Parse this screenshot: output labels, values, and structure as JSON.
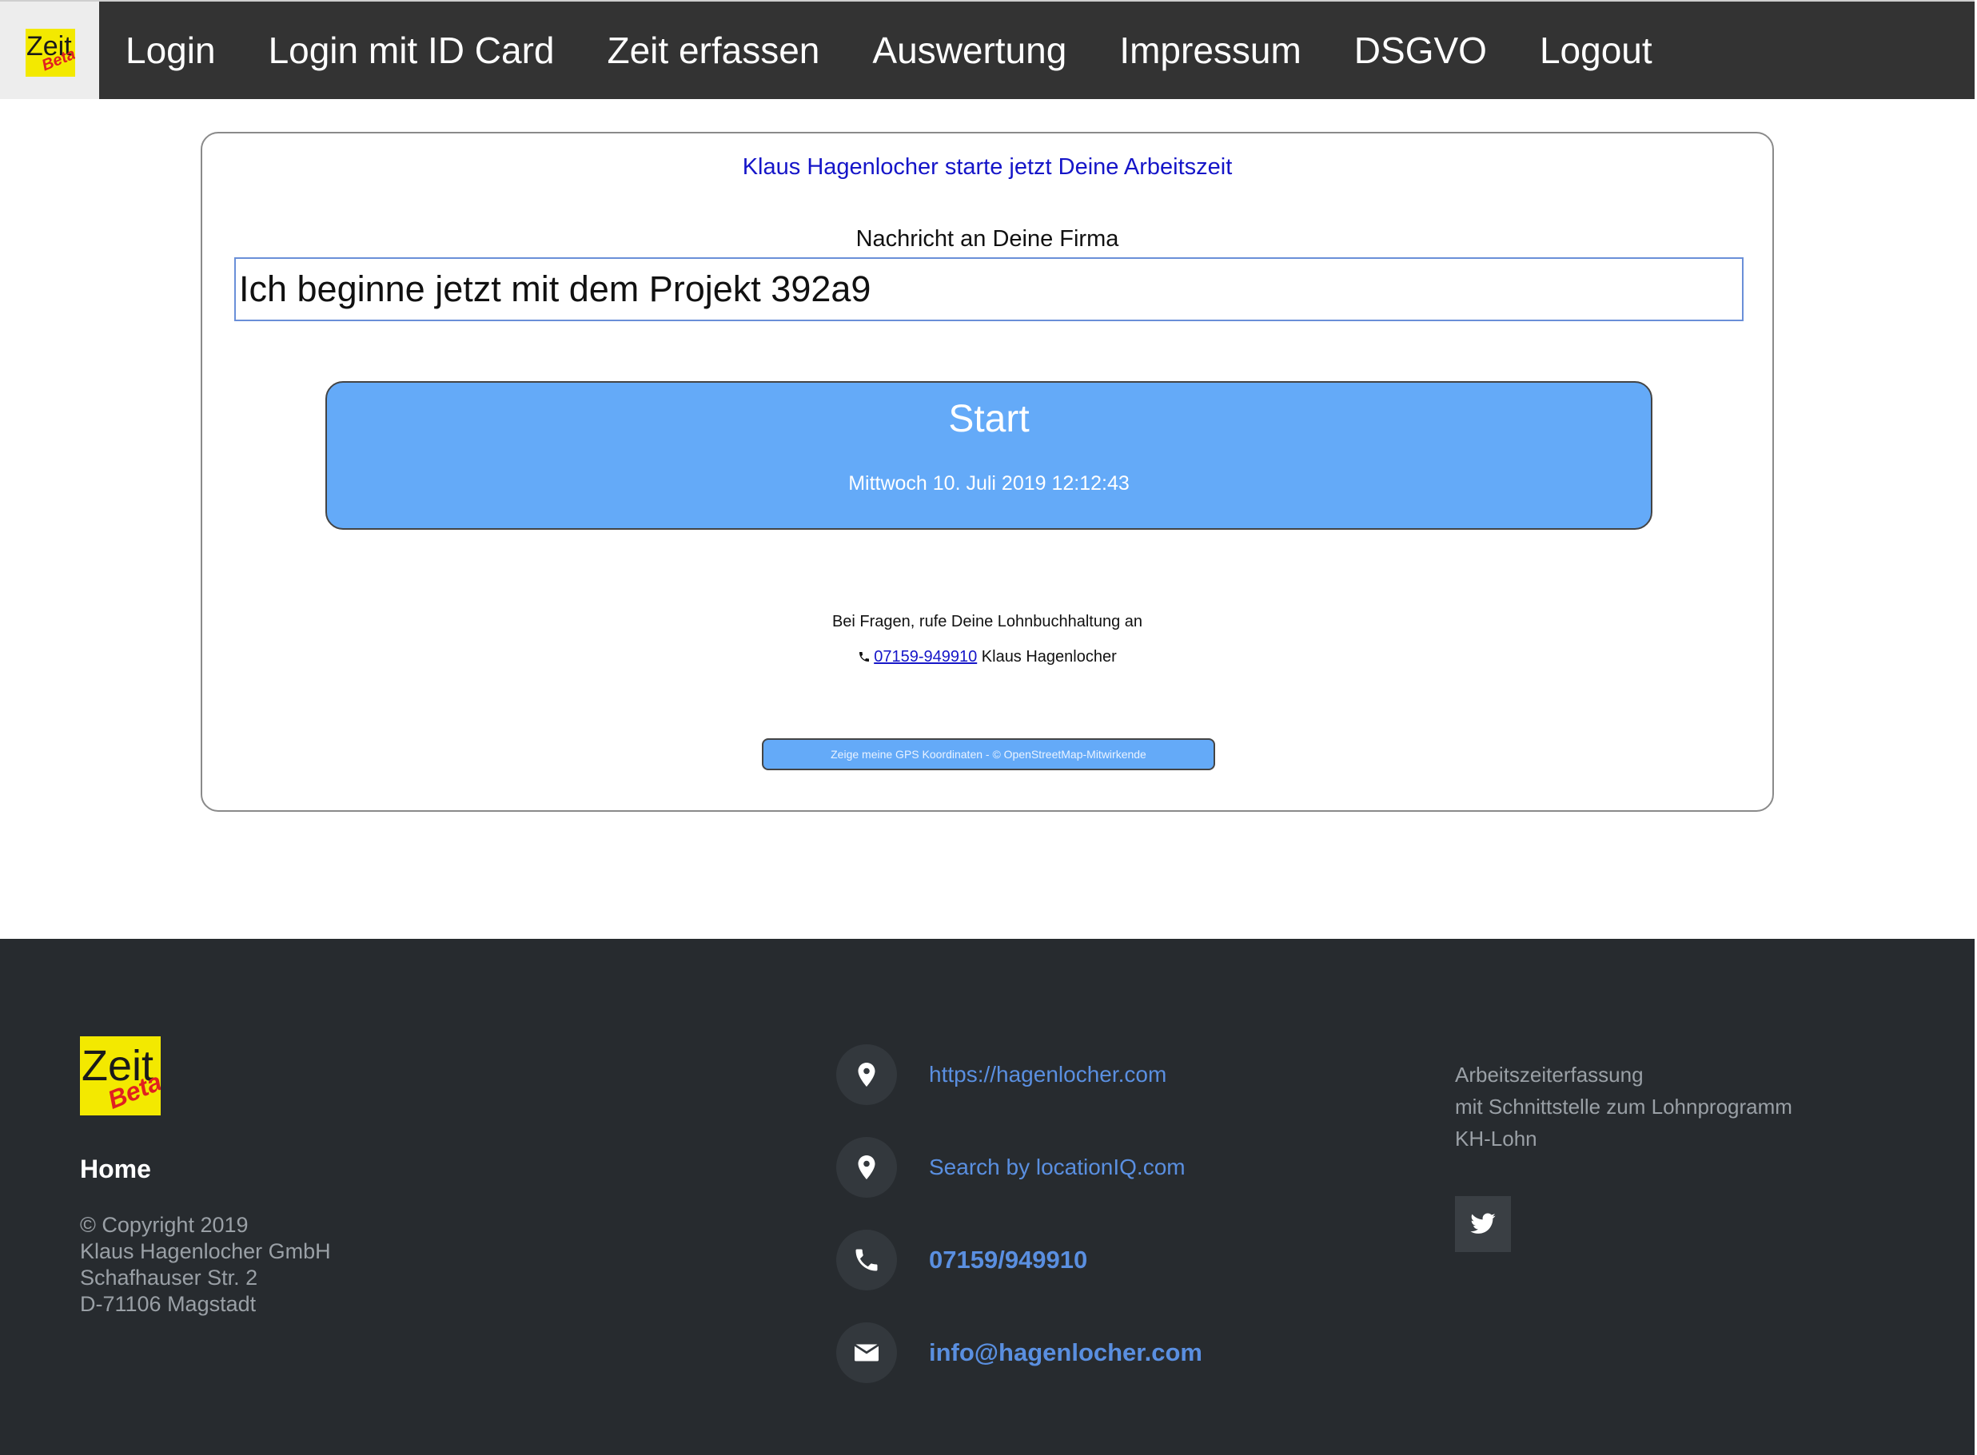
{
  "nav": {
    "logo": {
      "word": "Zeit",
      "badge": "Beta"
    },
    "items": [
      "Login",
      "Login mit ID Card",
      "Zeit erfassen",
      "Auswertung",
      "Impressum",
      "DSGVO",
      "Logout"
    ]
  },
  "main": {
    "headline": "Klaus Hagenlocher starte jetzt Deine Arbeitszeit",
    "message_label": "Nachricht an Deine Firma",
    "message_value": "Ich beginne jetzt mit dem Projekt 392a9",
    "start_button": {
      "label": "Start",
      "datetime": "Mittwoch 10. Juli 2019 12:12:43"
    },
    "help_text": "Bei Fragen, rufe Deine Lohnbuchhaltung an",
    "help_phone": "07159-949910",
    "help_name": "Klaus Hagenlocher",
    "gps_button": "Zeige meine GPS Koordinaten - © OpenStreetMap-Mitwirkende"
  },
  "footer": {
    "logo": {
      "word": "Zeit",
      "badge": "Beta"
    },
    "home": "Home",
    "copyright": [
      "© Copyright 2019",
      "Klaus Hagenlocher GmbH",
      "Schafhauser Str. 2",
      "D-71106 Magstadt"
    ],
    "contacts": [
      {
        "icon": "location-pin-icon",
        "text": "https://hagenlocher.com"
      },
      {
        "icon": "location-pin-icon",
        "text": "Search by locationIQ.com"
      },
      {
        "icon": "phone-icon",
        "text": "07159/949910"
      },
      {
        "icon": "envelope-icon",
        "text": "info@hagenlocher.com"
      }
    ],
    "about": [
      "Arbeitszeiterfassung",
      "mit Schnittstelle zum Lohnprogramm",
      "KH-Lohn"
    ],
    "social_icon": "twitter-icon"
  }
}
